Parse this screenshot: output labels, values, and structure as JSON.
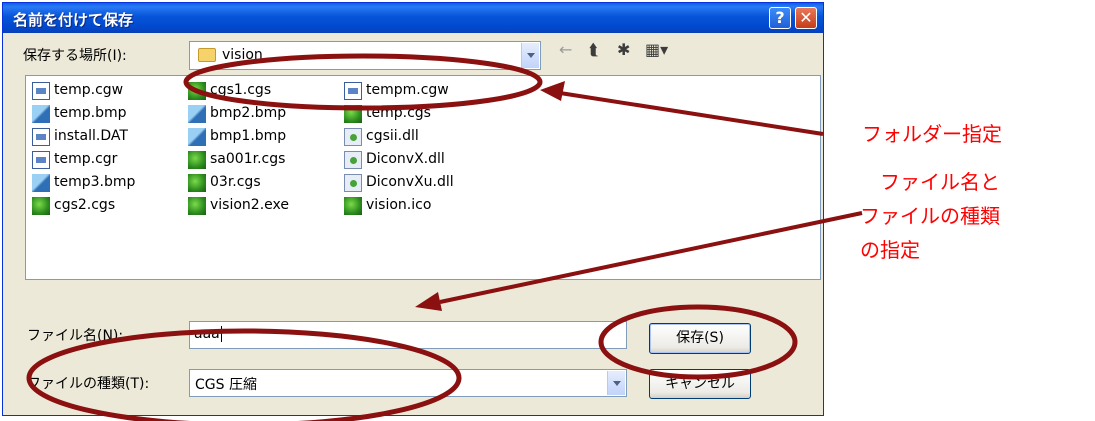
{
  "dialog": {
    "title": "名前を付けて保存",
    "help_label": "?",
    "close_label": "✕"
  },
  "lookin": {
    "label": "保存する場所(I):",
    "value": "vision"
  },
  "toolbar": {
    "back_icon": "←",
    "up_icon": "⮬",
    "newfolder_icon": "✱",
    "view_icon": "▦▾"
  },
  "files": {
    "col1": [
      {
        "name": "temp.cgw",
        "icon": "cgw"
      },
      {
        "name": "temp.bmp",
        "icon": "bmp"
      },
      {
        "name": "install.DAT",
        "icon": "cgw"
      },
      {
        "name": "temp.cgr",
        "icon": "cgw"
      },
      {
        "name": "temp3.bmp",
        "icon": "bmp"
      },
      {
        "name": "cgs2.cgs",
        "icon": "cgs"
      }
    ],
    "col2": [
      {
        "name": "cgs1.cgs",
        "icon": "cgs"
      },
      {
        "name": "bmp2.bmp",
        "icon": "bmp"
      },
      {
        "name": "bmp1.bmp",
        "icon": "bmp"
      },
      {
        "name": "sa001r.cgs",
        "icon": "cgs"
      },
      {
        "name": "03r.cgs",
        "icon": "cgs"
      },
      {
        "name": "vision2.exe",
        "icon": "cgs"
      }
    ],
    "col3": [
      {
        "name": "tempm.cgw",
        "icon": "cgw"
      },
      {
        "name": "temp.cgs",
        "icon": "cgs"
      },
      {
        "name": "cgsii.dll",
        "icon": "dll"
      },
      {
        "name": "DiconvX.dll",
        "icon": "dll"
      },
      {
        "name": "DiconvXu.dll",
        "icon": "dll"
      },
      {
        "name": "vision.ico",
        "icon": "cgs"
      }
    ]
  },
  "filename": {
    "label": "ファイル名(N):",
    "value": "aaa"
  },
  "filetype": {
    "label": "ファイルの種類(T):",
    "value": "CGS 圧縮"
  },
  "buttons": {
    "save": "保存(S)",
    "cancel": "キャンセル"
  },
  "annotations": {
    "folder": "フォルダー指定",
    "filename_line1": "ファイル名と",
    "filename_line2": "ファイルの種類",
    "filename_line3": "の指定"
  },
  "colors": {
    "annotation_text": "#ff0000",
    "ellipse_stroke": "#8b1010",
    "titlebar": "#0754d8"
  }
}
